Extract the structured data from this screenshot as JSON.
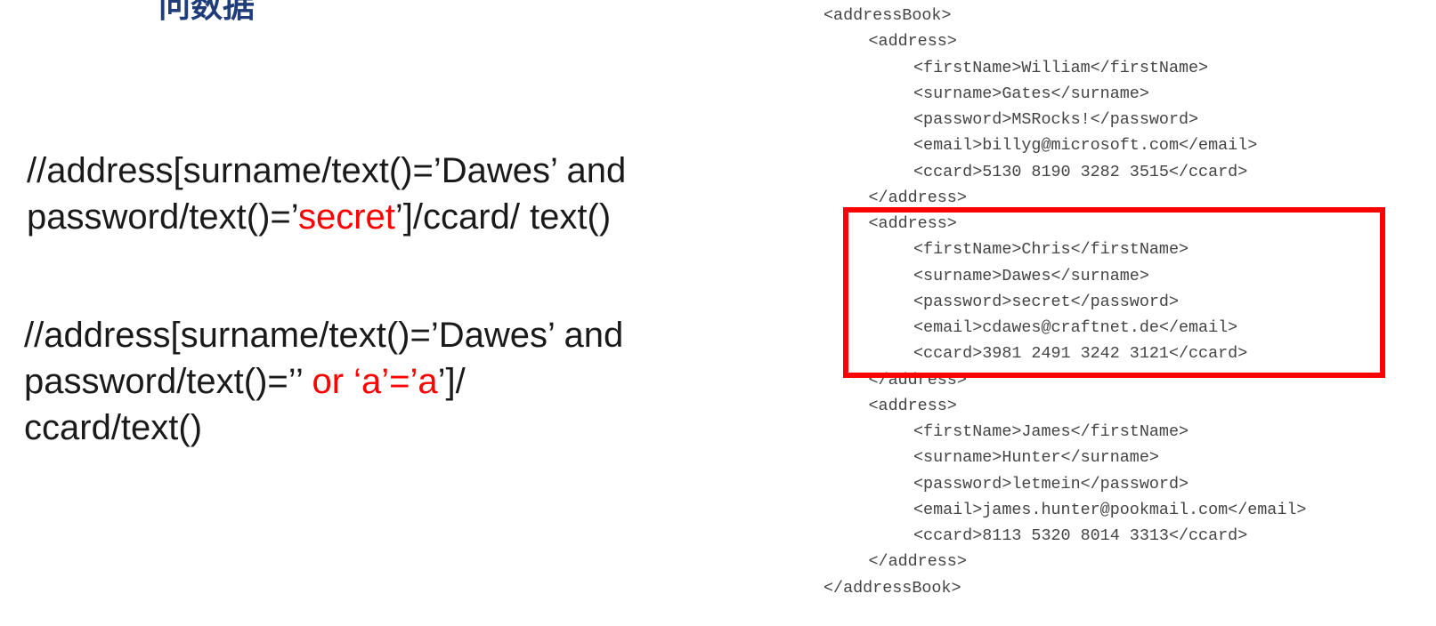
{
  "slide": {
    "title": "问数据"
  },
  "queries": [
    {
      "lines": [
        [
          {
            "text": "//address[surname/text()=’Dawes’ and",
            "highlight": false
          }
        ],
        [
          {
            "text": "password/text()=’",
            "highlight": false
          },
          {
            "text": "secret",
            "highlight": true
          },
          {
            "text": "’]/ccard/ text()",
            "highlight": false
          }
        ]
      ]
    },
    {
      "lines": [
        [
          {
            "text": "//address[surname/text()=’Dawes’ and",
            "highlight": false
          }
        ],
        [
          {
            "text": "password/text()=’’ ",
            "highlight": false
          },
          {
            "text": "or ‘a’=’a",
            "highlight": true
          },
          {
            "text": "’]/",
            "highlight": false
          }
        ],
        [
          {
            "text": "ccard/text()",
            "highlight": false
          }
        ]
      ]
    }
  ],
  "xml": {
    "lines": [
      {
        "indent": 0,
        "text": "<addressBook>"
      },
      {
        "indent": 1,
        "text": "<address>"
      },
      {
        "indent": 2,
        "text": "<firstName>William</firstName>"
      },
      {
        "indent": 2,
        "text": "<surname>Gates</surname>"
      },
      {
        "indent": 2,
        "text": "<password>MSRocks!</password>"
      },
      {
        "indent": 2,
        "text": "<email>billyg@microsoft.com</email>"
      },
      {
        "indent": 2,
        "text": "<ccard>5130 8190 3282 3515</ccard>"
      },
      {
        "indent": 1,
        "text": "</address>"
      },
      {
        "indent": 1,
        "text": "<address>"
      },
      {
        "indent": 2,
        "text": "<firstName>Chris</firstName>"
      },
      {
        "indent": 2,
        "text": "<surname>Dawes</surname>"
      },
      {
        "indent": 2,
        "text": "<password>secret</password>"
      },
      {
        "indent": 2,
        "text": "<email>cdawes@craftnet.de</email>"
      },
      {
        "indent": 2,
        "text": "<ccard>3981 2491 3242 3121</ccard>"
      },
      {
        "indent": 1,
        "text": "</address>"
      },
      {
        "indent": 1,
        "text": "<address>"
      },
      {
        "indent": 2,
        "text": "<firstName>James</firstName>"
      },
      {
        "indent": 2,
        "text": "<surname>Hunter</surname>"
      },
      {
        "indent": 2,
        "text": "<password>letmein</password>"
      },
      {
        "indent": 2,
        "text": "<email>james.hunter@pookmail.com</email>"
      },
      {
        "indent": 2,
        "text": "<ccard>8113 5320 8014 3313</ccard>"
      },
      {
        "indent": 1,
        "text": "</address>"
      },
      {
        "indent": 0,
        "text": "</addressBook>"
      }
    ]
  },
  "colors": {
    "title": "#1f3d7a",
    "query_text": "#1a1a1a",
    "injection_highlight": "#ff0000",
    "xml_text": "#444444",
    "highlight_box": "#ff0000"
  }
}
